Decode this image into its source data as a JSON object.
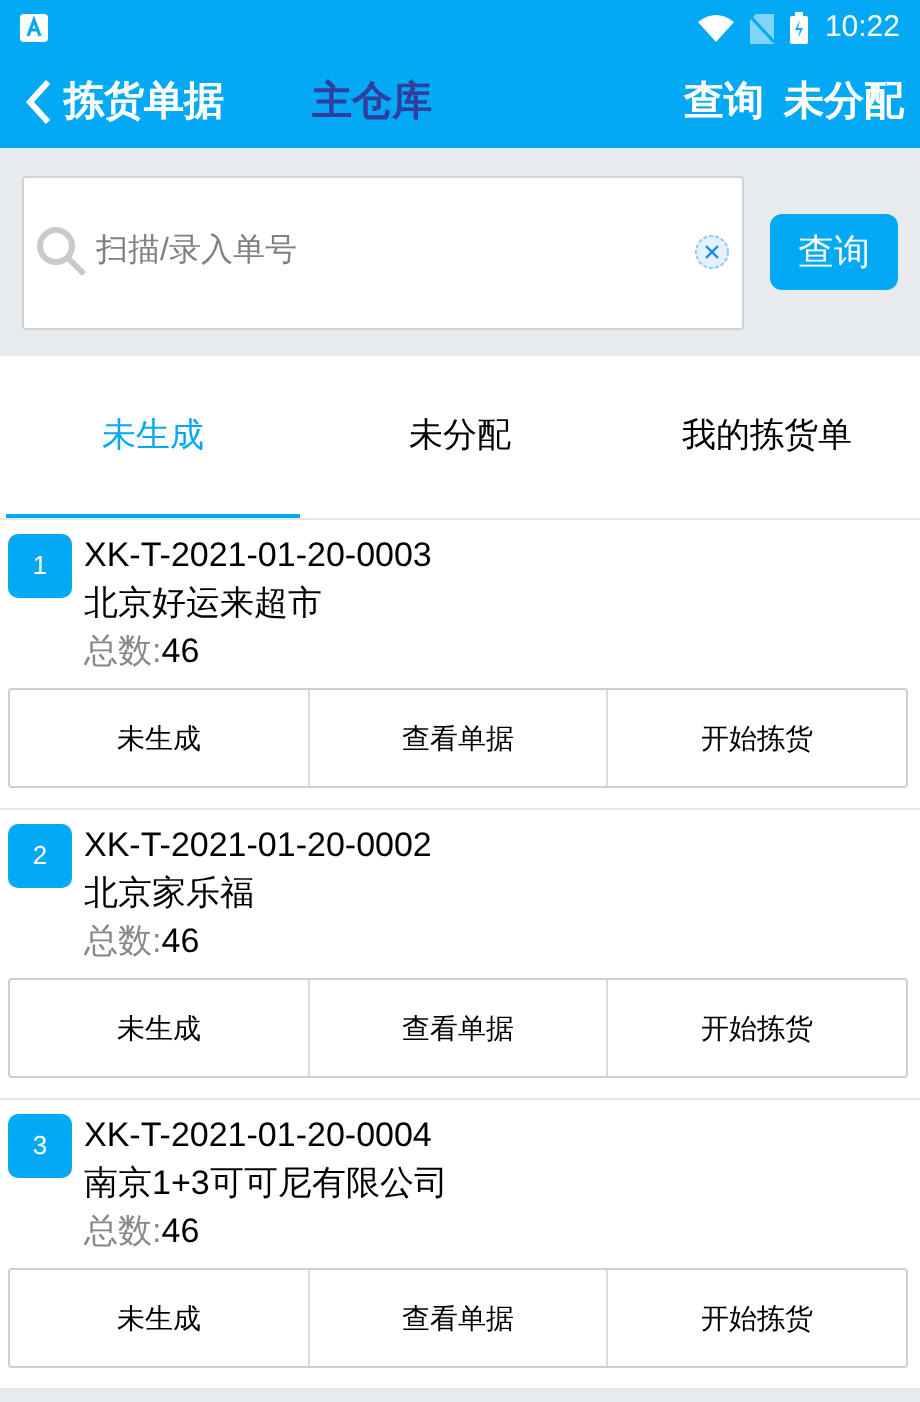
{
  "status_bar": {
    "time": "10:22"
  },
  "header": {
    "back_label": "拣货单据",
    "title": "主仓库",
    "actions": [
      "查询",
      "未分配"
    ]
  },
  "search": {
    "placeholder": "扫描/录入单号",
    "button": "查询"
  },
  "tabs": [
    {
      "label": "未生成",
      "selected": true
    },
    {
      "label": "未分配",
      "selected": false
    },
    {
      "label": "我的拣货单",
      "selected": false
    }
  ],
  "orders": [
    {
      "index": "1",
      "number": "XK-T-2021-01-20-0003",
      "customer": "北京好运来超市",
      "count_label": "总数:",
      "count": "46",
      "buttons": [
        "未生成",
        "查看单据",
        "开始拣货"
      ]
    },
    {
      "index": "2",
      "number": "XK-T-2021-01-20-0002",
      "customer": "北京家乐福",
      "count_label": "总数:",
      "count": "46",
      "buttons": [
        "未生成",
        "查看单据",
        "开始拣货"
      ]
    },
    {
      "index": "3",
      "number": "XK-T-2021-01-20-0004",
      "customer": "南京1+3可可尼有限公司",
      "count_label": "总数:",
      "count": "46",
      "buttons": [
        "未生成",
        "查看单据",
        "开始拣货"
      ]
    }
  ]
}
